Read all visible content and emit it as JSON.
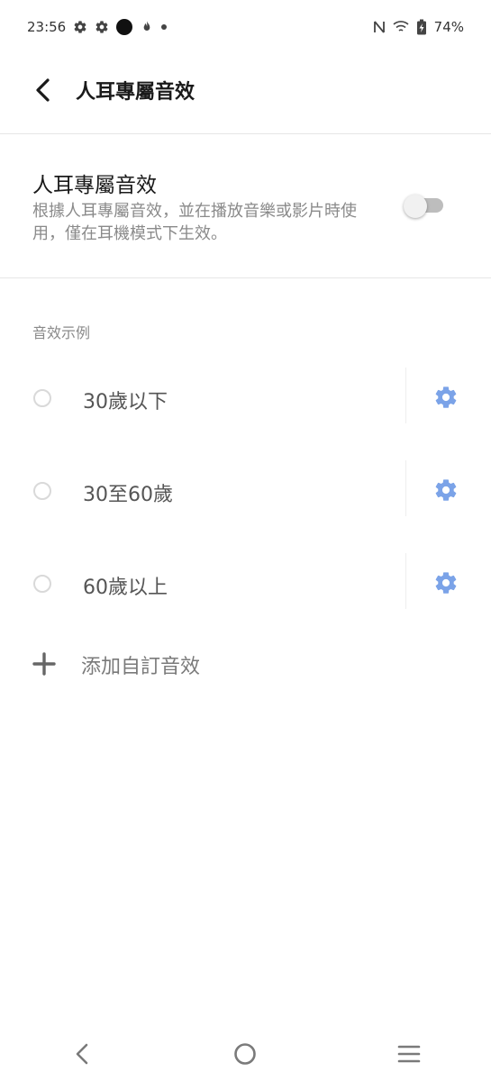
{
  "status_bar": {
    "time": "23:56",
    "battery": "74%",
    "icons_left": [
      "gear-icon",
      "gear-icon",
      "record-dot-icon",
      "fire-icon",
      "small-dot-icon"
    ],
    "icons_right": [
      "nfc-icon",
      "wifi-icon",
      "battery-charging-icon"
    ]
  },
  "header": {
    "title": "人耳專屬音效"
  },
  "setting": {
    "title": "人耳專屬音效",
    "description": "根據人耳專屬音效，並在播放音樂或影片時使用，僅在耳機模式下生效。",
    "enabled": false
  },
  "presets": {
    "section_label": "音效示例",
    "items": [
      {
        "label": "30歲以下",
        "selected": false
      },
      {
        "label": "30至60歲",
        "selected": false
      },
      {
        "label": "60歲以上",
        "selected": false
      }
    ]
  },
  "add_custom": {
    "label": "添加自訂音效"
  },
  "colors": {
    "accent": "#7ba3e8",
    "toggle_off": "#bdbdbd"
  }
}
